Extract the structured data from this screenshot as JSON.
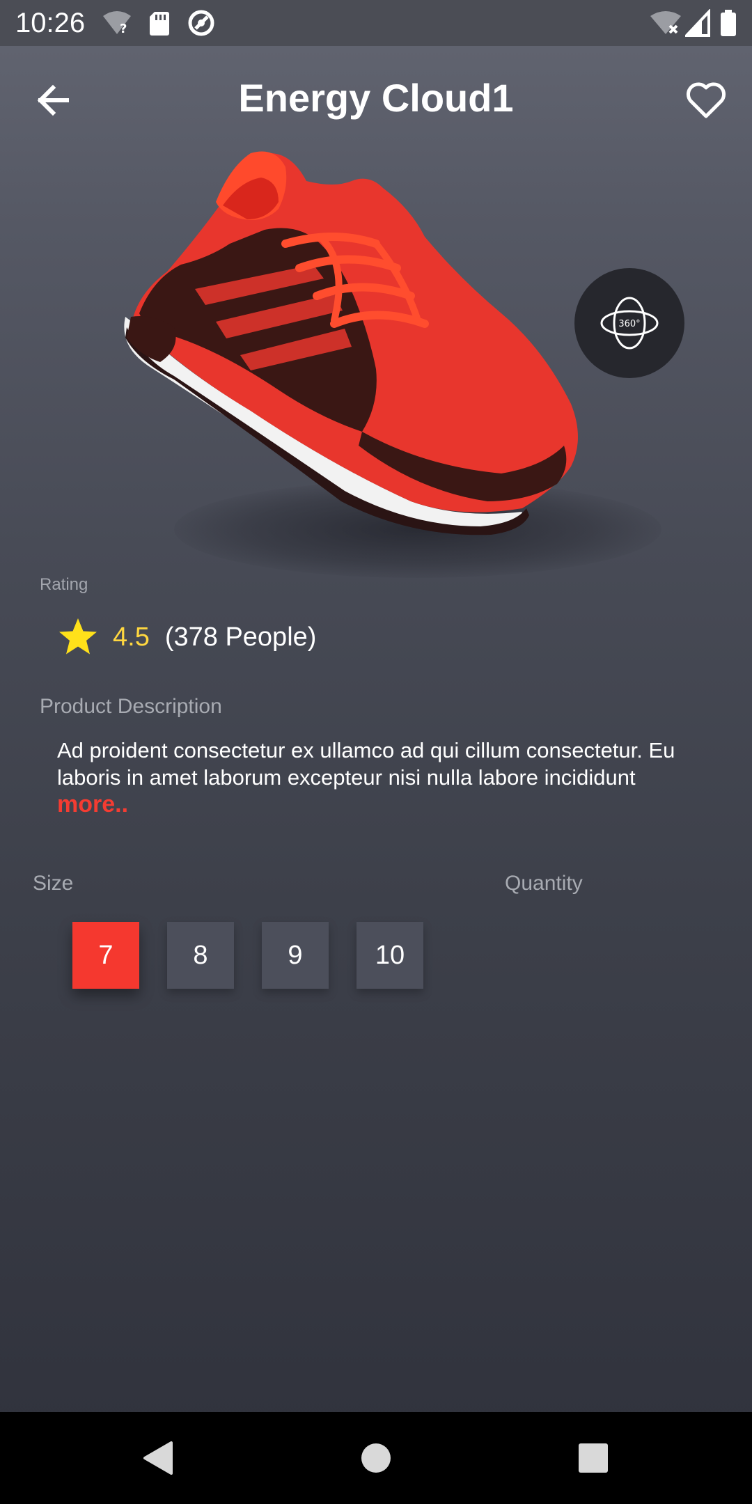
{
  "status_bar": {
    "time": "10:26",
    "left_icons": [
      "wifi-unknown-icon",
      "sd-card-icon",
      "at-sign-icon"
    ],
    "right_icons": [
      "wifi-off-icon",
      "cell-signal-icon",
      "battery-icon"
    ]
  },
  "header": {
    "title": "Energy Cloud1",
    "back_icon": "arrow-left-icon",
    "favorite_icon": "heart-outline-icon"
  },
  "product": {
    "image": "red-running-shoe",
    "view360_icon": "360-view-icon",
    "view360_badge": "360°"
  },
  "rating": {
    "label": "Rating",
    "value": "4.5",
    "count": "(378 People)",
    "star_color": "#ffe11a"
  },
  "description": {
    "label": "Product Description",
    "text": "Ad proident consectetur ex ullamco ad qui cillum consectetur. Eu laboris in amet laborum excepteur nisi nulla labore incididunt",
    "more_label": "more.."
  },
  "size": {
    "label": "Size",
    "options": [
      "7",
      "8",
      "9",
      "10"
    ],
    "selected": "7"
  },
  "quantity": {
    "label": "Quantity"
  },
  "colors": {
    "accent": "#f5382f",
    "rating_text": "#ffd740"
  },
  "nav_bar": {
    "buttons": [
      "back-triangle-icon",
      "home-circle-icon",
      "recents-square-icon"
    ]
  }
}
